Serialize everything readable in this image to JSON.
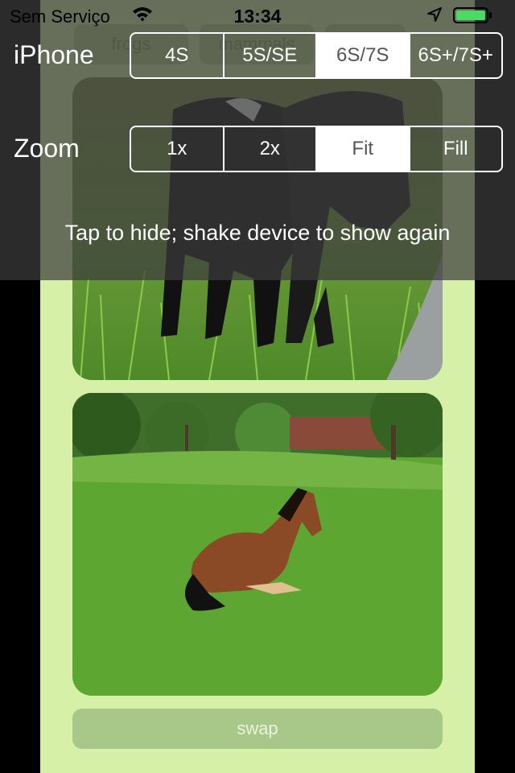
{
  "status_bar": {
    "carrier": "Sem Serviço",
    "time": "13:34",
    "battery_level": 1.0,
    "battery_color": "#4cd964"
  },
  "background_tabs": [
    "frogs",
    "mammals"
  ],
  "device_row": {
    "label": "iPhone",
    "options": [
      "4S",
      "5S/SE",
      "6S/7S",
      "6S+/7S+"
    ],
    "selected": "6S/7S"
  },
  "zoom_row": {
    "label": "Zoom",
    "options": [
      "1x",
      "2x",
      "Fit",
      "Fill"
    ],
    "selected": "Fit"
  },
  "hint": "Tap to hide; shake device to show again",
  "swap_button": "swap",
  "photos": [
    {
      "subject": "black calves in grass"
    },
    {
      "subject": "brown horse lying on lawn"
    }
  ],
  "colors": {
    "app_background": "#d6f0a8",
    "overlay": "rgba(60,60,60,0.72)",
    "swap_button": "#a7c888"
  }
}
